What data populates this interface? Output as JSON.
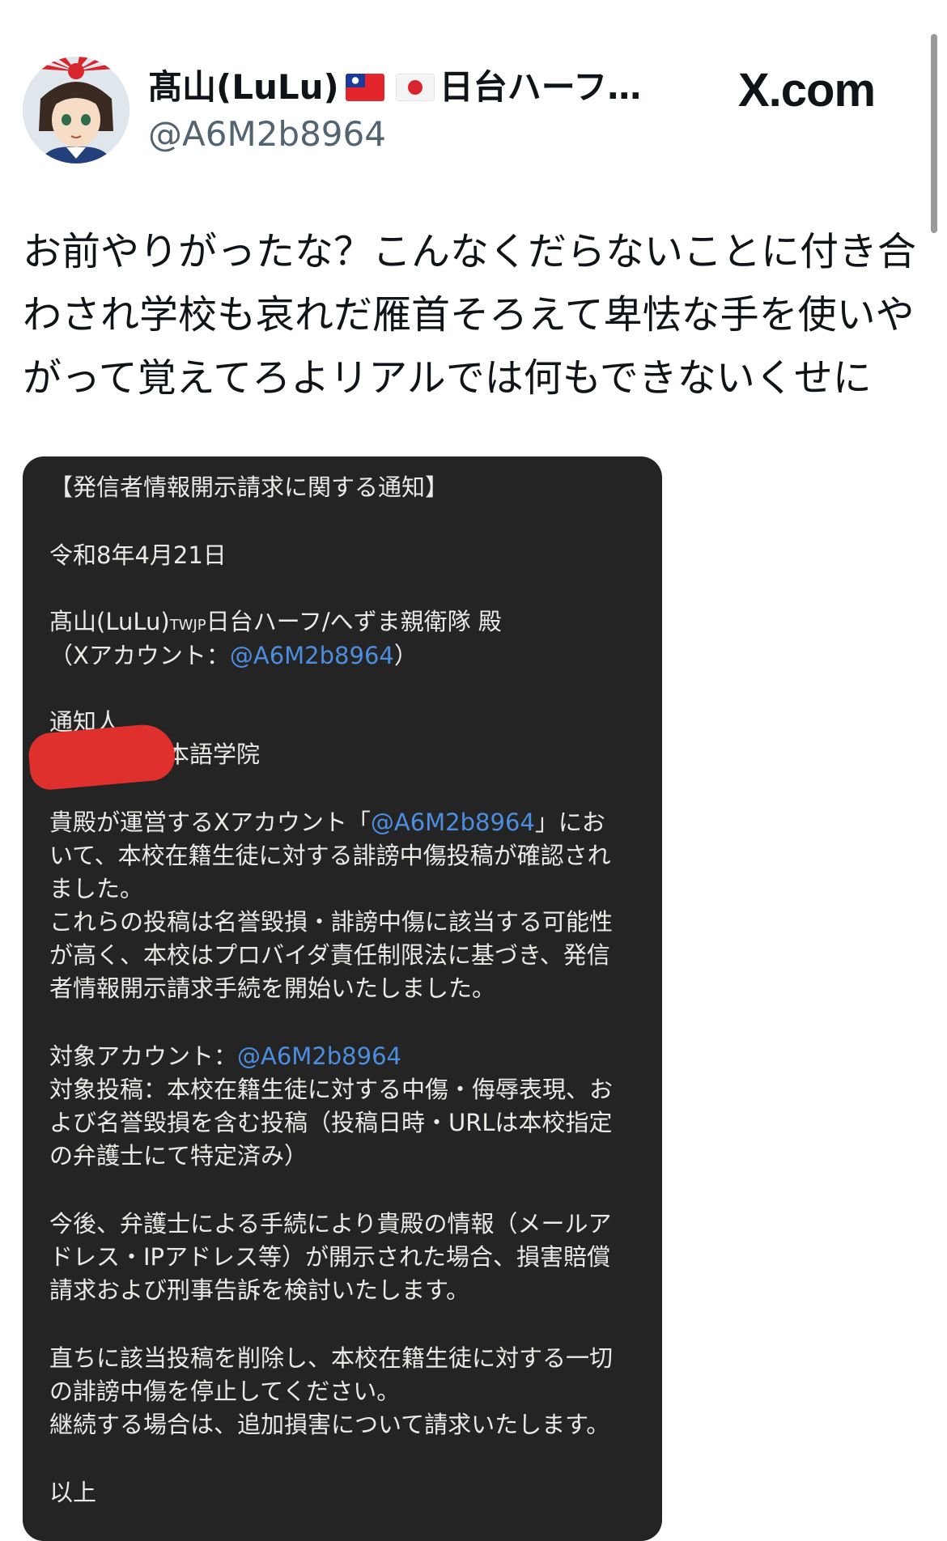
{
  "tweet": {
    "author": {
      "display_name": "髙山(LuLu)",
      "name_suffix": "日台ハーフ…",
      "flags": [
        "taiwan-flag-icon",
        "japan-flag-icon"
      ],
      "handle": "@A6M2b8964"
    },
    "site_logo": "X.com",
    "text_lines": [
      "お前やりがったな？こんなくだらないことに付き合",
      "わされ学校も哀れだ雁首そろえて卑怯な手を使いや",
      "がって覚えてろよリアルでは何もできないくせに"
    ]
  },
  "notice": {
    "title": "【発信者情報開示請求に関する通知】",
    "date": "令和8年4月21日",
    "addressee_a": "髙山(LuLu)",
    "addressee_sub": "TWJP",
    "addressee_b": "日台ハーフ/へずま親衛隊 殿",
    "account_prefix": "（Xアカウント：",
    "account_handle": "@A6M2b8964",
    "account_suffix": "）",
    "notifier_label": "通知人",
    "notifier_name": "日本語学院",
    "p1_l1_prefix": "貴殿が運営するXアカウント「",
    "p1_l1_handle": "@A6M2b8964",
    "p1_l1_suffix": "」にお",
    "p1_l2": "いて、本校在籍生徒に対する誹謗中傷投稿が確認され",
    "p1_l3": "ました。",
    "p2_l1": "これらの投稿は名誉毀損・誹謗中傷に該当する可能性",
    "p2_l2": "が高く、本校はプロバイダ責任制限法に基づき、発信",
    "p2_l3": "者情報開示請求手続を開始いたしました。",
    "target_account_label": "対象アカウント：",
    "target_account_handle": "@A6M2b8964",
    "target_post_l1": "対象投稿：本校在籍生徒に対する中傷・侮辱表現、お",
    "target_post_l2": "よび名誉毀損を含む投稿（投稿日時・URLは本校指定",
    "target_post_l3": "の弁護士にて特定済み）",
    "p3_l1": "今後、弁護士による手続により貴殿の情報（メールア",
    "p3_l2": "ドレス・IPアドレス等）が開示された場合、損害賠償",
    "p3_l3": "請求および刑事告訴を検討いたします。",
    "p4_l1": "直ちに該当投稿を削除し、本校在籍生徒に対する一切",
    "p4_l2": "の誹謗中傷を停止してください。",
    "p4_l3": "継続する場合は、追加損害について請求いたします。",
    "closing": "以上"
  },
  "colors": {
    "text": "#0f1419",
    "handle_gray": "#536471",
    "notice_bg": "#242424",
    "notice_text": "#eceae6",
    "link_blue": "#4c8de0",
    "redaction_red": "#e0302e"
  }
}
